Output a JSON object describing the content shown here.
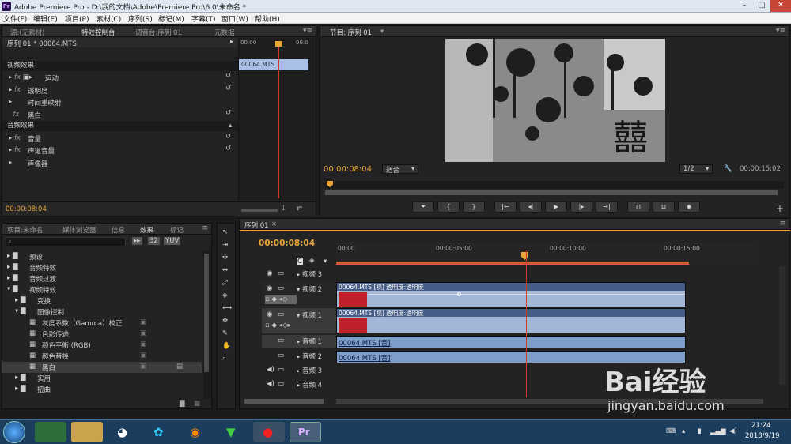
{
  "window": {
    "title": "Adobe Premiere Pro - D:\\我的文档\\Adobe\\Premiere Pro\\6.0\\未命名 *",
    "app_badge": "Pr"
  },
  "menu": [
    "文件(F)",
    "编辑(E)",
    "项目(P)",
    "素材(C)",
    "序列(S)",
    "标记(M)",
    "字幕(T)",
    "窗口(W)",
    "帮助(H)"
  ],
  "source_panel": {
    "tabs": [
      "源:(无素材)",
      "特效控制台",
      "调音台:序列 01",
      "元数据"
    ],
    "clip_label": "序列 01 * 00064.MTS",
    "timecode_zero": "00:00",
    "timecode_end": "00:0",
    "mini_clip": "00064.MTS",
    "video_section": "视频效果",
    "video_effects": [
      "运动",
      "透明度",
      "时间重映射",
      "黑白"
    ],
    "audio_section": "音频效果",
    "audio_effects": [
      "音量",
      "声道音量",
      "声像器"
    ],
    "current_time": "00:00:08:04"
  },
  "program": {
    "tab": "节目: 序列 01",
    "timecode": "00:00:08:04",
    "fit": "适合",
    "quality": "1/2",
    "duration": "00:00:15:02",
    "controls": [
      "marker",
      "in",
      "out",
      "goto-in",
      "step-back",
      "play",
      "step-forward",
      "goto-out",
      "lift",
      "extract",
      "export-frame"
    ]
  },
  "project_panel": {
    "tabs": [
      "项目:未命名",
      "媒体浏览器",
      "信息",
      "效果",
      "标记"
    ],
    "search_placeholder": "",
    "tree": [
      {
        "label": "预设",
        "level": 0
      },
      {
        "label": "音频特效",
        "level": 0
      },
      {
        "label": "音频过渡",
        "level": 0
      },
      {
        "label": "视频特效",
        "level": 0
      },
      {
        "label": "变换",
        "level": 1
      },
      {
        "label": "图像控制",
        "level": 1
      },
      {
        "label": "灰度系数（Gamma）校正",
        "level": 2
      },
      {
        "label": "色彩传递",
        "level": 2
      },
      {
        "label": "颜色平衡 (RGB)",
        "level": 2
      },
      {
        "label": "颜色替换",
        "level": 2
      },
      {
        "label": "黑白",
        "level": 2
      },
      {
        "label": "实用",
        "level": 1
      },
      {
        "label": "扭曲",
        "level": 1
      }
    ]
  },
  "timeline": {
    "tab": "序列 01",
    "timecode": "00:00:08:04",
    "ruler": [
      "00:00",
      "00:00:05:00",
      "00:00:10:00",
      "00:00:15:00"
    ],
    "tracks": [
      {
        "name": "视频 3"
      },
      {
        "name": "视频 2",
        "clip": "00064.MTS [视] 透明度:透明度"
      },
      {
        "name": "视频 1",
        "clip": "00064.MTS [视] 透明度:透明度"
      },
      {
        "name": "音频 1",
        "clip": "00064.MTS [音]"
      },
      {
        "name": "音频 2",
        "clip": "00064.MTS [音]"
      },
      {
        "name": "音频 3"
      },
      {
        "name": "音频 4"
      }
    ]
  },
  "taskbar": {
    "time": "21:24",
    "date": "2018/9/19"
  },
  "watermark": {
    "brand": "Bai经验",
    "url": "jingyan.baidu.com"
  },
  "colors": {
    "accent": "#e8a53a",
    "playhead": "#d23b2c",
    "clip_video": "#a3b6d8",
    "clip_audio": "#7e9ec9"
  }
}
